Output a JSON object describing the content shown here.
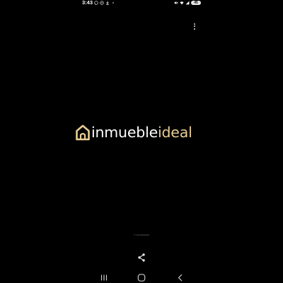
{
  "status_bar": {
    "time": "3:43",
    "battery": "45",
    "left_icons": [
      "whatsapp-icon",
      "messenger-icon",
      "download-icon",
      "dot-icon"
    ],
    "right_icons": [
      "mute-icon",
      "wifi-icon",
      "signal-icon"
    ]
  },
  "logo": {
    "part_bold": "inmueble",
    "part_light": "ideal",
    "icon": "house-icon",
    "colors": {
      "gold": "#e8cd94",
      "white": "#ffffff"
    }
  },
  "caption": "© inmuebleideal",
  "toolbar": {
    "menu_icon": "more-vert-icon",
    "share_icon": "share-icon"
  },
  "navigation": {
    "recents_icon": "recents-icon",
    "home_icon": "home-icon",
    "back_icon": "back-icon"
  },
  "colors": {
    "background": "#000000",
    "nav_icon": "#c8c8c8"
  }
}
